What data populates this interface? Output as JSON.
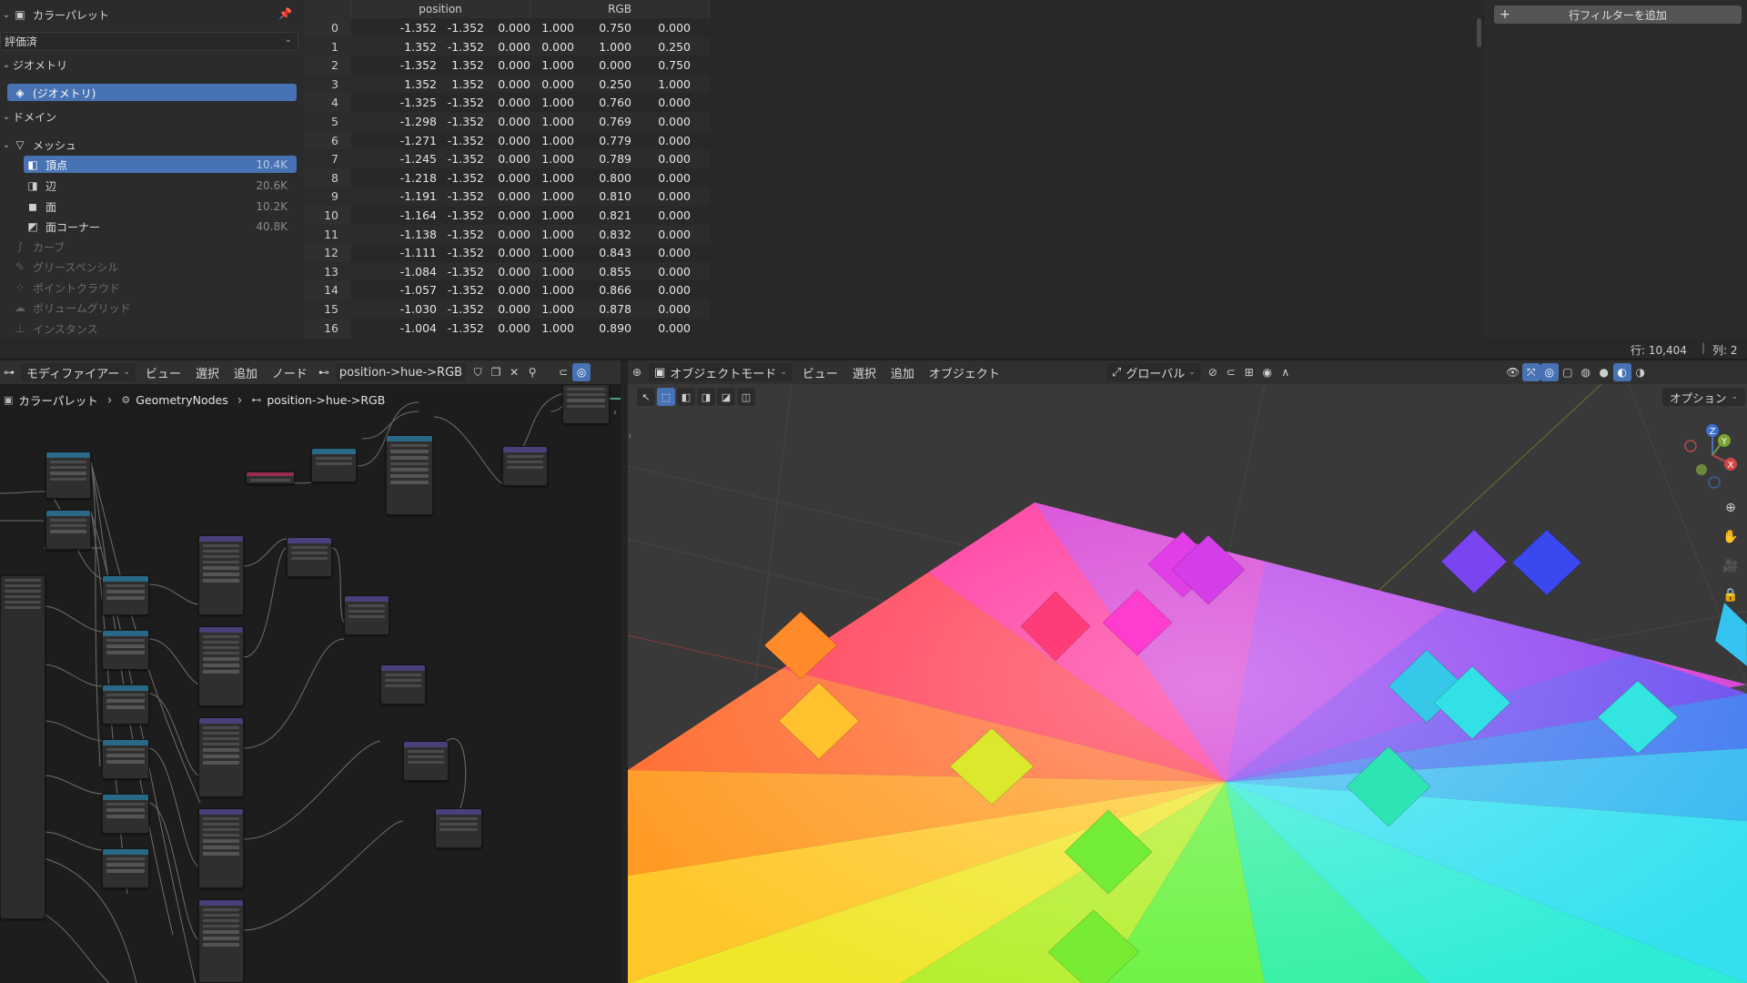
{
  "sidebar": {
    "object_name": "カラーパレット",
    "evaluation_dropdown": "評価済",
    "geometry_section": "ジオメトリ",
    "geometry_item": "(ジオメトリ)",
    "domain_section": "ドメイン",
    "mesh_label": "メッシュ",
    "domains": [
      {
        "label": "頂点",
        "count": "10.4K",
        "icon": "vertex-icon"
      },
      {
        "label": "辺",
        "count": "20.6K",
        "icon": "edge-icon"
      },
      {
        "label": "面",
        "count": "10.2K",
        "icon": "face-icon"
      },
      {
        "label": "面コーナー",
        "count": "40.8K",
        "icon": "face-corner-icon"
      }
    ],
    "disabled_types": [
      "カーブ",
      "グリースペンシル",
      "ポイントクラウド",
      "ボリュームグリッド",
      "インスタンス"
    ]
  },
  "table": {
    "columns": [
      "position",
      "RGB"
    ],
    "rows": [
      [
        "0",
        "-1.352",
        "-1.352",
        "0.000",
        "1.000",
        "0.750",
        "0.000"
      ],
      [
        "1",
        "1.352",
        "-1.352",
        "0.000",
        "0.000",
        "1.000",
        "0.250"
      ],
      [
        "2",
        "-1.352",
        "1.352",
        "0.000",
        "1.000",
        "0.000",
        "0.750"
      ],
      [
        "3",
        "1.352",
        "1.352",
        "0.000",
        "0.000",
        "0.250",
        "1.000"
      ],
      [
        "4",
        "-1.325",
        "-1.352",
        "0.000",
        "1.000",
        "0.760",
        "0.000"
      ],
      [
        "5",
        "-1.298",
        "-1.352",
        "0.000",
        "1.000",
        "0.769",
        "0.000"
      ],
      [
        "6",
        "-1.271",
        "-1.352",
        "0.000",
        "1.000",
        "0.779",
        "0.000"
      ],
      [
        "7",
        "-1.245",
        "-1.352",
        "0.000",
        "1.000",
        "0.789",
        "0.000"
      ],
      [
        "8",
        "-1.218",
        "-1.352",
        "0.000",
        "1.000",
        "0.800",
        "0.000"
      ],
      [
        "9",
        "-1.191",
        "-1.352",
        "0.000",
        "1.000",
        "0.810",
        "0.000"
      ],
      [
        "10",
        "-1.164",
        "-1.352",
        "0.000",
        "1.000",
        "0.821",
        "0.000"
      ],
      [
        "11",
        "-1.138",
        "-1.352",
        "0.000",
        "1.000",
        "0.832",
        "0.000"
      ],
      [
        "12",
        "-1.111",
        "-1.352",
        "0.000",
        "1.000",
        "0.843",
        "0.000"
      ],
      [
        "13",
        "-1.084",
        "-1.352",
        "0.000",
        "1.000",
        "0.855",
        "0.000"
      ],
      [
        "14",
        "-1.057",
        "-1.352",
        "0.000",
        "1.000",
        "0.866",
        "0.000"
      ],
      [
        "15",
        "-1.030",
        "-1.352",
        "0.000",
        "1.000",
        "0.878",
        "0.000"
      ],
      [
        "16",
        "-1.004",
        "-1.352",
        "0.000",
        "1.000",
        "0.890",
        "0.000"
      ]
    ]
  },
  "filter": {
    "add_filter_label": "行フィルターを追加"
  },
  "status": {
    "rows_label": "行: 10,404",
    "cols_label": "列: 2"
  },
  "node_header": {
    "menus": [
      "モディファイアー",
      "ビュー",
      "選択",
      "追加",
      "ノード"
    ],
    "node_group_name": "position->hue->RGB"
  },
  "breadcrumb": {
    "items": [
      "カラーパレット",
      "GeometryNodes",
      "position->hue->RGB"
    ]
  },
  "viewport_header": {
    "mode": "オブジェクトモード",
    "menus": [
      "ビュー",
      "選択",
      "追加",
      "オブジェクト"
    ],
    "transform_orientation": "グローバル"
  },
  "viewport": {
    "options_label": "オプション",
    "axis_labels": [
      "Z",
      "Y",
      "X"
    ]
  },
  "colors": {
    "accent": "#4772b3",
    "header": "#303030",
    "panel": "#2b2b2b"
  }
}
